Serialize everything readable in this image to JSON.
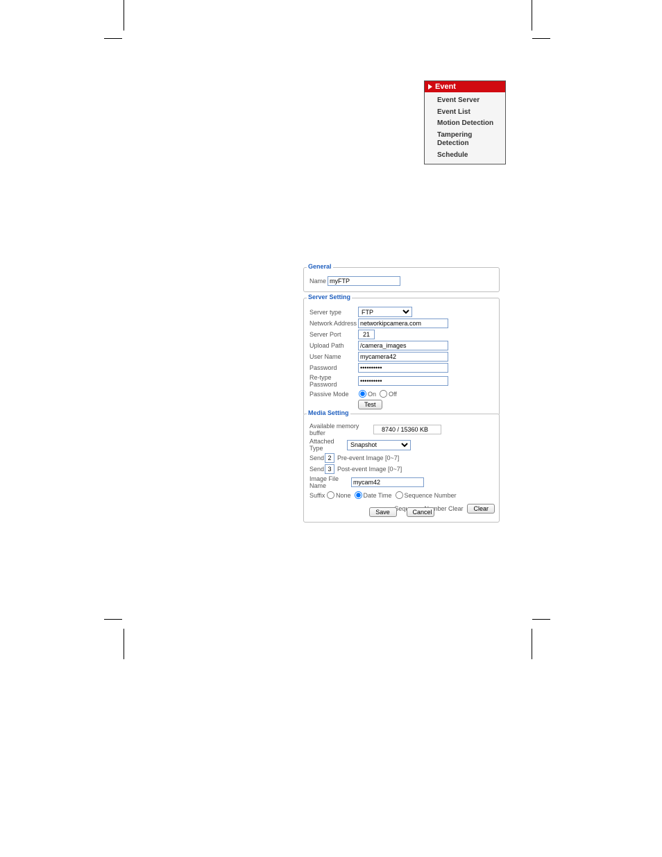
{
  "nav": {
    "header": "Event",
    "items": [
      {
        "label": "Event Server"
      },
      {
        "label": "Event List"
      },
      {
        "label": "Motion Detection"
      },
      {
        "label": "Tampering Detection"
      },
      {
        "label": "Schedule"
      }
    ]
  },
  "general": {
    "legend": "General",
    "name_label": "Name",
    "name_value": "myFTP"
  },
  "server": {
    "legend": "Server Setting",
    "type_label": "Server type",
    "type_value": "FTP",
    "address_label": "Network Address",
    "address_value": "networkipcamera.com",
    "port_label": "Server Port",
    "port_value": "21",
    "upload_label": "Upload Path",
    "upload_value": "/camera_images",
    "user_label": "User Name",
    "user_value": "mycamera42",
    "pass_label": "Password",
    "pass_value": "••••••••••",
    "repass_label": "Re-type Password",
    "repass_value": "••••••••••",
    "passive_label": "Passive Mode",
    "on_label": "On",
    "off_label": "Off",
    "passive_value": "on",
    "test_label": "Test"
  },
  "media": {
    "legend": "Media Setting",
    "buffer_label": "Available memory buffer",
    "buffer_value": "8740 / 15360 KB",
    "attached_label": "Attached Type",
    "attached_value": "Snapshot",
    "send_label": "Send",
    "pre_value": "2",
    "pre_hint": "Pre-event Image [0~7]",
    "post_value": "3",
    "post_hint": "Post-event Image [0~7]",
    "filename_label": "Image File Name",
    "filename_value": "mycam42",
    "suffix_label": "Suffix",
    "suffix_none": "None",
    "suffix_date": "Date Time",
    "suffix_seq": "Sequence Number",
    "suffix_value": "date",
    "seqclear_label": "Sequence Number Clear",
    "clear_label": "Clear"
  },
  "buttons": {
    "save": "Save",
    "cancel": "Cancel"
  }
}
